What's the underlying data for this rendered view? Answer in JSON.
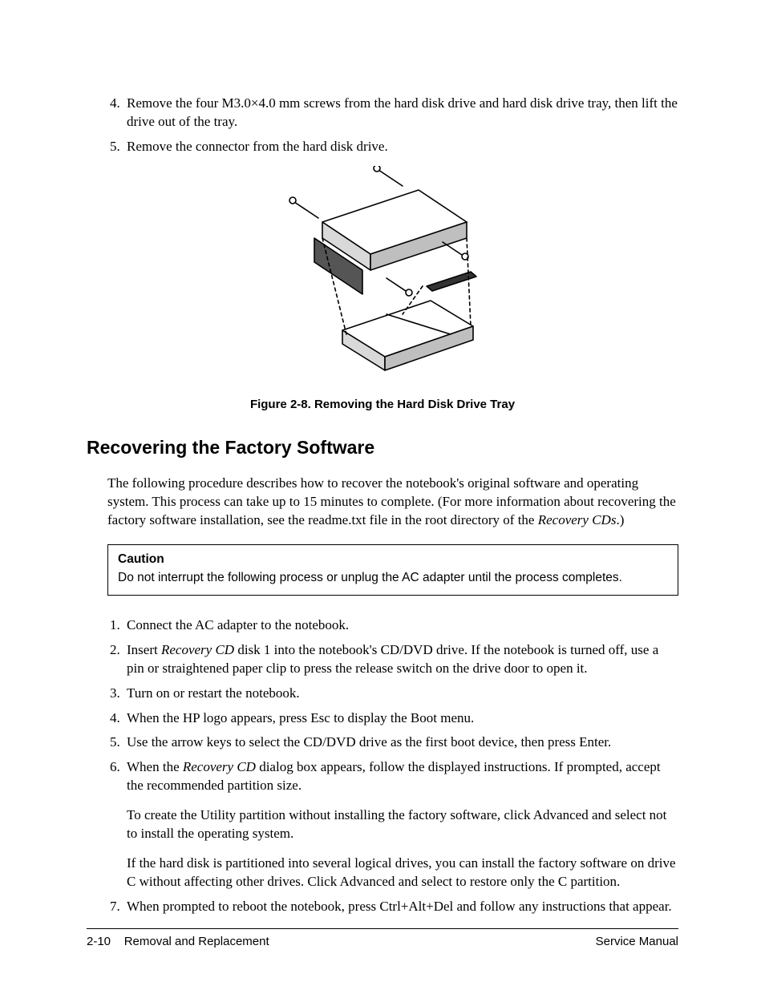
{
  "steps_top": [
    {
      "n": 4,
      "text": "Remove the four M3.0×4.0 mm screws from the hard disk drive and hard disk drive tray, then lift the drive out of the tray."
    },
    {
      "n": 5,
      "text": "Remove the connector from the hard disk drive."
    }
  ],
  "figure": {
    "caption": "Figure 2-8. Removing the Hard Disk Drive Tray"
  },
  "section_title": "Recovering the Factory Software",
  "intro": {
    "prefix": "The following procedure describes how to recover the notebook's original software and operating system. This process can take up to 15 minutes to complete. (For more information about recovering the factory software installation, see the readme.txt file in the root directory of the ",
    "italic": "Recovery CDs",
    "suffix": ".)"
  },
  "caution": {
    "title": "Caution",
    "text": "Do not interrupt the following process or unplug the AC adapter until the process completes."
  },
  "proc": [
    {
      "n": 1,
      "parts": [
        {
          "t": "Connect the AC adapter to the notebook."
        }
      ]
    },
    {
      "n": 2,
      "parts": [
        {
          "t": "Insert "
        },
        {
          "i": "Recovery CD"
        },
        {
          "t": " disk 1 into the notebook's CD/DVD drive. If the notebook is turned off, use a pin or straightened paper clip to press the release switch on the drive door to open it."
        }
      ]
    },
    {
      "n": 3,
      "parts": [
        {
          "t": "Turn on or restart the notebook."
        }
      ]
    },
    {
      "n": 4,
      "parts": [
        {
          "t": "When the HP logo appears, press Esc to display the Boot menu."
        }
      ]
    },
    {
      "n": 5,
      "parts": [
        {
          "t": "Use the arrow keys to select the CD/DVD drive as the first boot device, then press Enter."
        }
      ]
    },
    {
      "n": 6,
      "parts": [
        {
          "t": "When the "
        },
        {
          "i": "Recovery CD"
        },
        {
          "t": " dialog box appears, follow the displayed instructions. If prompted, accept the recommended partition size."
        }
      ],
      "extra": [
        "To create the Utility partition without installing the factory software, click Advanced and select not to install the operating system.",
        "If the hard disk is partitioned into several logical drives, you can install the factory software on drive C without affecting other drives. Click Advanced and select to restore only the C partition."
      ]
    },
    {
      "n": 7,
      "parts": [
        {
          "t": "When prompted to reboot the notebook, press Ctrl+Alt+Del and follow any instructions that appear."
        }
      ]
    }
  ],
  "footer": {
    "page": "2-10",
    "left": "Removal and Replacement",
    "right": "Service Manual"
  }
}
